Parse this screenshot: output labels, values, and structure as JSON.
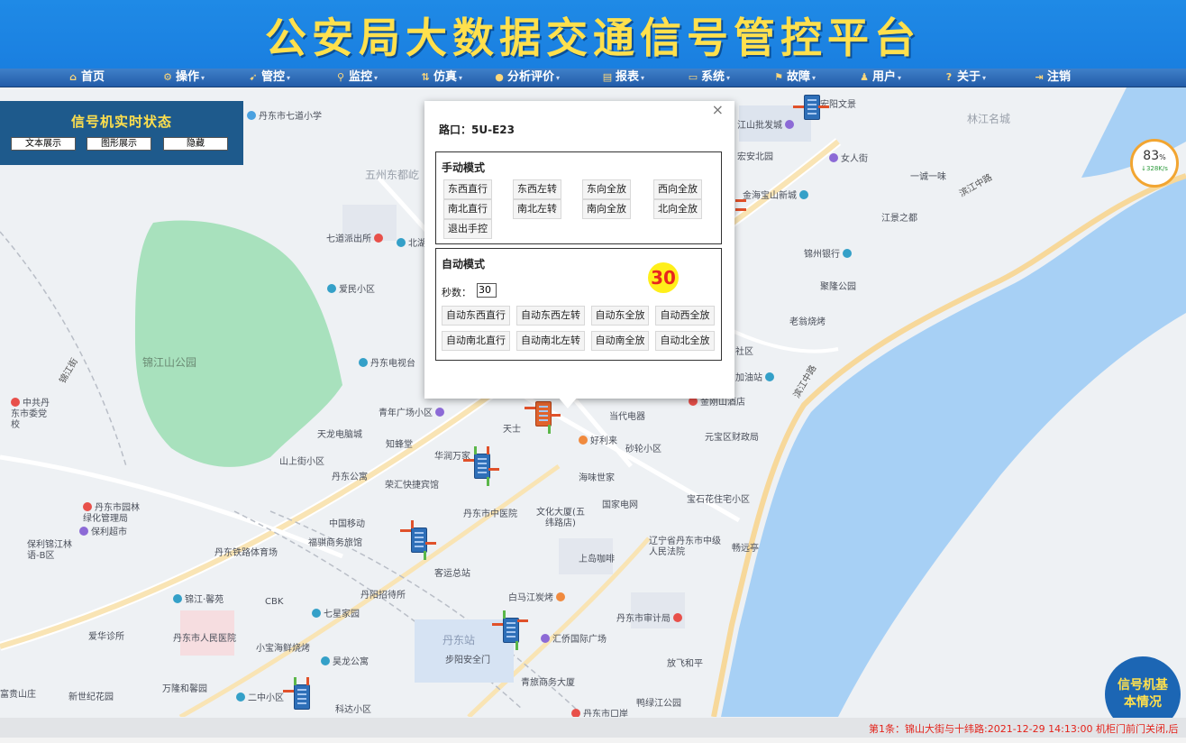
{
  "app_title": "公安局大数据交通信号管控平台",
  "nav": [
    {
      "label": "首页",
      "icon": "home-icon",
      "dropdown": false
    },
    {
      "label": "操作",
      "icon": "operation-icon",
      "dropdown": true
    },
    {
      "label": "管控",
      "icon": "control-icon",
      "dropdown": true
    },
    {
      "label": "监控",
      "icon": "monitor-icon",
      "dropdown": true
    },
    {
      "label": "仿真",
      "icon": "simulation-icon",
      "dropdown": true
    },
    {
      "label": "分析评价",
      "icon": "search-icon",
      "dropdown": true
    },
    {
      "label": "报表",
      "icon": "report-icon",
      "dropdown": true
    },
    {
      "label": "系统",
      "icon": "system-icon",
      "dropdown": true
    },
    {
      "label": "故障",
      "icon": "fault-icon",
      "dropdown": true
    },
    {
      "label": "用户",
      "icon": "user-icon",
      "dropdown": true
    },
    {
      "label": "关于",
      "icon": "help-icon",
      "dropdown": true
    },
    {
      "label": "注销",
      "icon": "logout-icon",
      "dropdown": false
    }
  ],
  "status_panel": {
    "title": "信号机实时状态",
    "buttons": [
      "文本展示",
      "图形展示",
      "隐藏"
    ]
  },
  "dialog": {
    "junction_label": "路口：5U-E23",
    "manual": {
      "title": "手动模式",
      "buttons": [
        "东西直行",
        "东西左转",
        "东向全放",
        "西向全放",
        "南北直行",
        "南北左转",
        "南向全放",
        "北向全放",
        "退出手控"
      ]
    },
    "auto": {
      "title": "自动模式",
      "countdown": "30",
      "seconds_label": "秒数：",
      "seconds_value": "30",
      "buttons": [
        "自动东西直行",
        "自动东西左转",
        "自动东全放",
        "自动西全放",
        "自动南北直行",
        "自动南北左转",
        "自动南全放",
        "自动北全放"
      ]
    }
  },
  "gauge": {
    "percent": "83",
    "percent_unit": "%",
    "speed": "↓328K/s"
  },
  "basic_info_button": "信号机基本情况",
  "ticker": "第1条：锦山大街与十纬路:2021-12-29 14:13:00 机柜门前门关闭,后",
  "map": {
    "areas": [
      "锦江山公园",
      "五州东都屹",
      "林江名城",
      "丹东站"
    ],
    "roads": [
      "滨江中路",
      "滨江中路",
      "锦江街"
    ],
    "pois": [
      "丹东市七道小学",
      "七道派出所",
      "北湖",
      "爱民小区",
      "丹东电视台",
      "中共丹东市委党校",
      "天龙电脑城",
      "知蜂堂",
      "华润万家",
      "山上街小区",
      "丹东公寓",
      "荣汇快捷宾馆",
      "丹东市园林绿化管理局",
      "保利超市",
      "保利锦江林语-B区",
      "丹东铁路体育场",
      "中国移动",
      "福骐商务旅馆",
      "丹东市中医院",
      "文化大厦(五纬路店)",
      "客运总站",
      "丹阳招待所",
      "锦江·馨苑",
      "CBK",
      "七星家园",
      "爱华诊所",
      "丹东市人民医院",
      "小宝海鲜烧烤",
      "昊龙公寓",
      "万隆和馨园",
      "二中小区",
      "富贵山庄",
      "新世纪花园",
      "科达小区",
      "白马江炭烤",
      "汇侨国际广场",
      "步阳安全门",
      "青旅商务大厦",
      "丹东市口岸",
      "丹东市审计局",
      "放飞和平",
      "鸭绿江公园",
      "辽宁省丹东市中级人民法院",
      "畅远亭",
      "上岛咖啡",
      "国家电网",
      "宝石花住宅小区",
      "海味世家",
      "砂轮小区",
      "好利来",
      "元宝区财政局",
      "当代电器",
      "金刚山酒店",
      "加油站",
      "社区",
      "老翁烧烤",
      "聚隆公园",
      "锦州银行",
      "江景之都",
      "金海宝山新城",
      "女人街",
      "一诚一味",
      "宏安北园",
      "江山批发城",
      "宏阳文景",
      "青年广场小区",
      "天士"
    ]
  }
}
